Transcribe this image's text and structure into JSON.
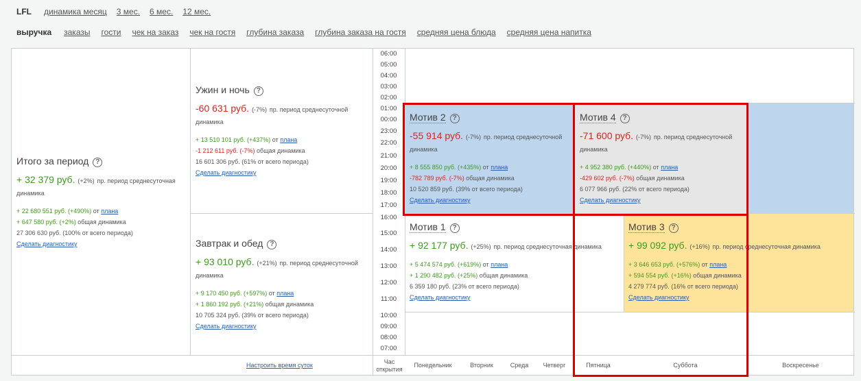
{
  "tabs_top": [
    "LFL",
    "динамика месяц",
    "3 мес.",
    "6 мес.",
    "12 мес."
  ],
  "tabs_metrics": [
    "выручка",
    "заказы",
    "гости",
    "чек на заказ",
    "чек на гостя",
    "глубина заказа",
    "глубина заказа на гостя",
    "средняя цена блюда",
    "средняя цена напитка"
  ],
  "total": {
    "title": "Итого за период",
    "main_value": "+ 32 379 руб.",
    "main_pct": "(+2%)",
    "main_desc": "пр. период среднесуточная динамика",
    "line1_value": "+ 22 680 551 руб. (+490%)",
    "line1_text": "от",
    "line1_link": "плана",
    "line2_value": "+ 647 580 руб. (+2%)",
    "line2_text": "общая динамика",
    "line3": "27 306 630 руб. (100% от всего периода)",
    "link": "Сделать диагностику"
  },
  "dinner": {
    "title": "Ужин и ночь",
    "main_value": "-60 631 руб.",
    "main_pct": "(-7%)",
    "main_desc": "пр. период среднесуточной динамика",
    "line1_value": "+ 13 510 101 руб. (+437%)",
    "line1_text": "от",
    "line1_link": "плана",
    "line2_value": "-1 212 611 руб. (-7%)",
    "line2_text": "общая динамика",
    "line3": "16 601 306 руб. (61% от всего периода)",
    "link": "Сделать диагностику"
  },
  "breakfast": {
    "title": "Завтрак и обед",
    "main_value": "+ 93 010 руб.",
    "main_pct": "(+21%)",
    "main_desc": "пр. период среднесуточной динамика",
    "line1_value": "+ 9 170 450 руб. (+597%)",
    "line1_text": "от",
    "line1_link": "плана",
    "line2_value": "+ 1 860 192 руб. (+21%)",
    "line2_text": "общая динамика",
    "line3": "10 705 324 руб. (39% от всего периода)",
    "link": "Сделать диагностику"
  },
  "motive2": {
    "title": "Мотив 2",
    "main_value": "-55 914 руб.",
    "main_pct": "(-7%)",
    "main_desc": "пр. период среднесуточной динамика",
    "line1_value": "+ 8 555 850 руб. (+435%)",
    "line1_text": "от",
    "line1_link": "плана",
    "line2_value": "-782 789 руб. (-7%)",
    "line2_text": "общая динамика",
    "line3": "10 520 859 руб. (39% от всего периода)",
    "link": "Сделать диагностику"
  },
  "motive4": {
    "title": "Мотив 4",
    "main_value": "-71 600 руб.",
    "main_pct": "(-7%)",
    "main_desc": "пр. период среднесуточной динамика",
    "line1_value": "+ 4 952 380 руб. (+440%)",
    "line1_text": "от",
    "line1_link": "плана",
    "line2_value": "-429 602 руб. (-7%)",
    "line2_text": "общая динамика",
    "line3": "6 077 966 руб. (22% от всего периода)",
    "link": "Сделать диагностику"
  },
  "motive1": {
    "title": "Мотив 1",
    "main_value": "+ 92 177 руб.",
    "main_pct": "(+25%)",
    "main_desc": "пр. период среднесуточная динамика",
    "line1_value": "+ 5 474 574 руб. (+619%)",
    "line1_text": "от",
    "line1_link": "плана",
    "line2_value": "+ 1 290 482 руб. (+25%)",
    "line2_text": "общая динамика",
    "line3": "6 359 180 руб. (23% от всего периода)",
    "link": "Сделать диагностику"
  },
  "motive3": {
    "title": "Мотив 3",
    "main_value": "+ 99 092 руб.",
    "main_pct": "(+16%)",
    "main_desc": "пр. период среднесуточная динамика",
    "line1_value": "+ 3 646 653 руб. (+576%)",
    "line1_text": "от",
    "line1_link": "плана",
    "line2_value": "+ 594 554 руб. (+16%)",
    "line2_text": "общая динамика",
    "line3": "4 279 774 руб. (16% от всего периода)",
    "link": "Сделать диагностику"
  },
  "hours": [
    "06:00",
    "05:00",
    "04:00",
    "03:00",
    "02:00",
    "01:00",
    "00:00",
    "23:00",
    "22:00",
    "21:00",
    "20:00",
    "19:00",
    "18:00",
    "17:00",
    "16:00",
    "15:00",
    "14:00",
    "13:00",
    "12:00",
    "11:00",
    "10:00",
    "09:00",
    "08:00",
    "07:00"
  ],
  "footer": {
    "configure_link": "Настроить время суток",
    "open_hour": "Час открытия",
    "days": [
      "Понедельник",
      "Вторник",
      "Среда",
      "Четверг",
      "Пятница",
      "Суббота",
      "Воскресенье"
    ]
  },
  "colors": {
    "blue_cell": "#bdd6ee",
    "grey_cell": "#e6e6e6",
    "yellow_cell": "#fde49a",
    "highlight": "#dd0000",
    "negative": "#d8261b",
    "positive": "#3e9a1e"
  }
}
